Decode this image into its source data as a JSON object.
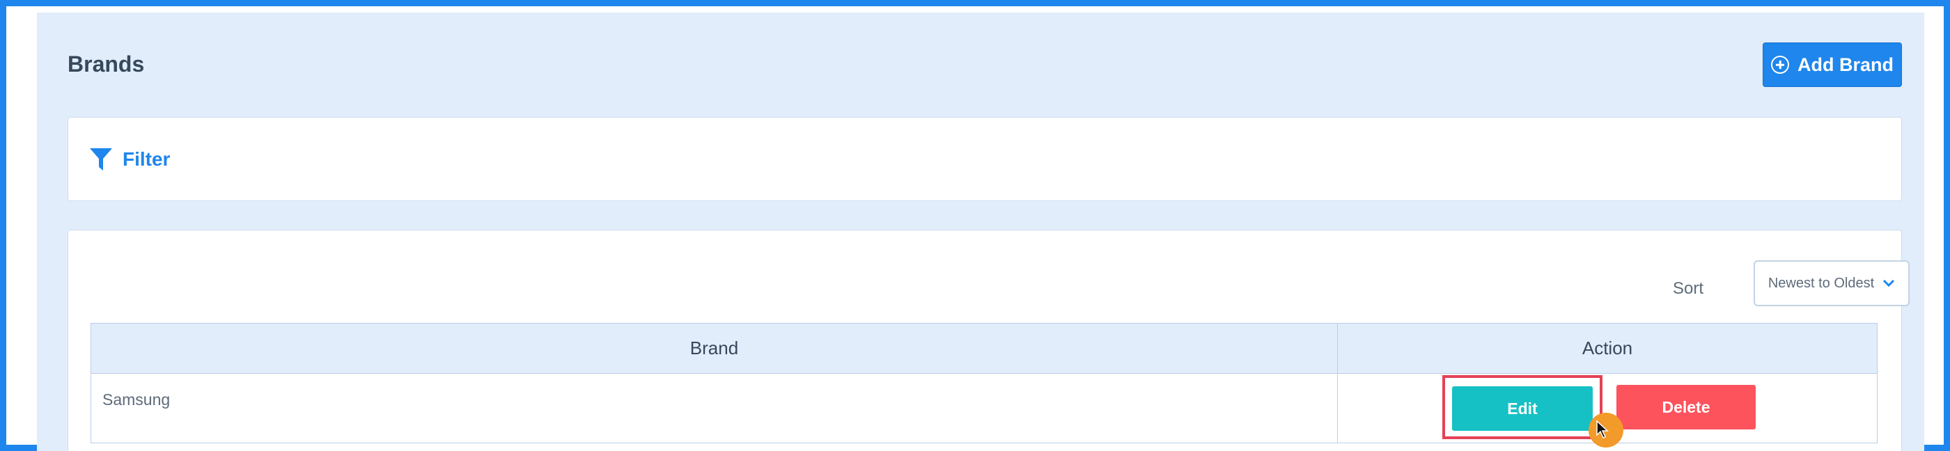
{
  "page": {
    "title": "Brands",
    "add_button_label": "Add Brand"
  },
  "filter": {
    "label": "Filter"
  },
  "sort": {
    "label": "Sort",
    "selected": "Newest to Oldest"
  },
  "table": {
    "headers": [
      "Brand",
      "Action"
    ],
    "rows": [
      {
        "brand": "Samsung",
        "edit_label": "Edit",
        "delete_label": "Delete"
      }
    ]
  },
  "colors": {
    "accent": "#1e86ec",
    "edit": "#15c1c4",
    "delete": "#fc535c",
    "highlight": "#e44256",
    "cursor": "#f29a2a"
  },
  "icons": [
    "plus-circle-icon",
    "filter-funnel-icon",
    "chevron-down-icon",
    "mouse-cursor-icon"
  ]
}
